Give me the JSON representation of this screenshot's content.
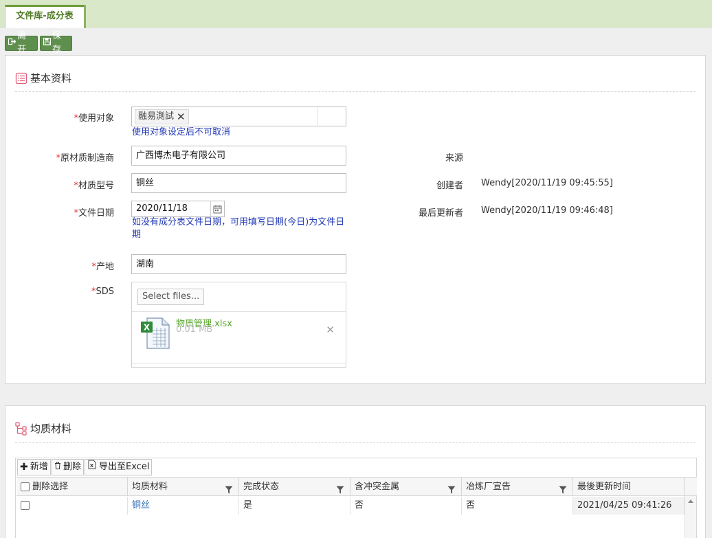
{
  "tab": {
    "title": "文件库-成分表"
  },
  "toolbar": {
    "leave_label": "离开",
    "save_label": "保存"
  },
  "basic": {
    "title": "基本资料",
    "fields": {
      "target_label": "使用对象",
      "target_chip": "融易測試",
      "target_hint": "使用对象设定后不可取消",
      "manufacturer_label": "原材质制造商",
      "manufacturer_value": "广西博杰电子有限公司",
      "model_label": "材质型号",
      "model_value": "铜丝",
      "date_label": "文件日期",
      "date_value": "2020/11/18",
      "date_hint": "如没有成分表文件日期，可用填写日期(今日)为文件日期",
      "origin_label": "产地",
      "origin_value": "湖南",
      "sds_label": "SDS",
      "select_files": "Select files...",
      "file_name": "物质管理.xlsx",
      "file_size": "0.01 MB"
    },
    "right": {
      "source_label": "来源",
      "source_value": "",
      "creator_label": "创建者",
      "creator_value": "Wendy[2020/11/19 09:45:55]",
      "updater_label": "最后更新者",
      "updater_value": "Wendy[2020/11/19 09:46:48]"
    }
  },
  "homogeneous": {
    "title": "均质材料",
    "buttons": {
      "add": "新增",
      "delete": "删除",
      "export": "导出至Excel"
    },
    "columns": [
      "删除选择",
      "均质材料",
      "完成状态",
      "含冲突金属",
      "冶炼厂宣告",
      "最後更新时间"
    ],
    "rows": [
      {
        "material": "铜丝",
        "status": "是",
        "conflict": "否",
        "smelter": "否",
        "updated": "2021/04/25 09:41:26"
      }
    ]
  },
  "colors": {
    "accent": "#6c9c3a",
    "hint": "#2239b6",
    "link": "#2f6db5",
    "file_link": "#5aa62e"
  }
}
